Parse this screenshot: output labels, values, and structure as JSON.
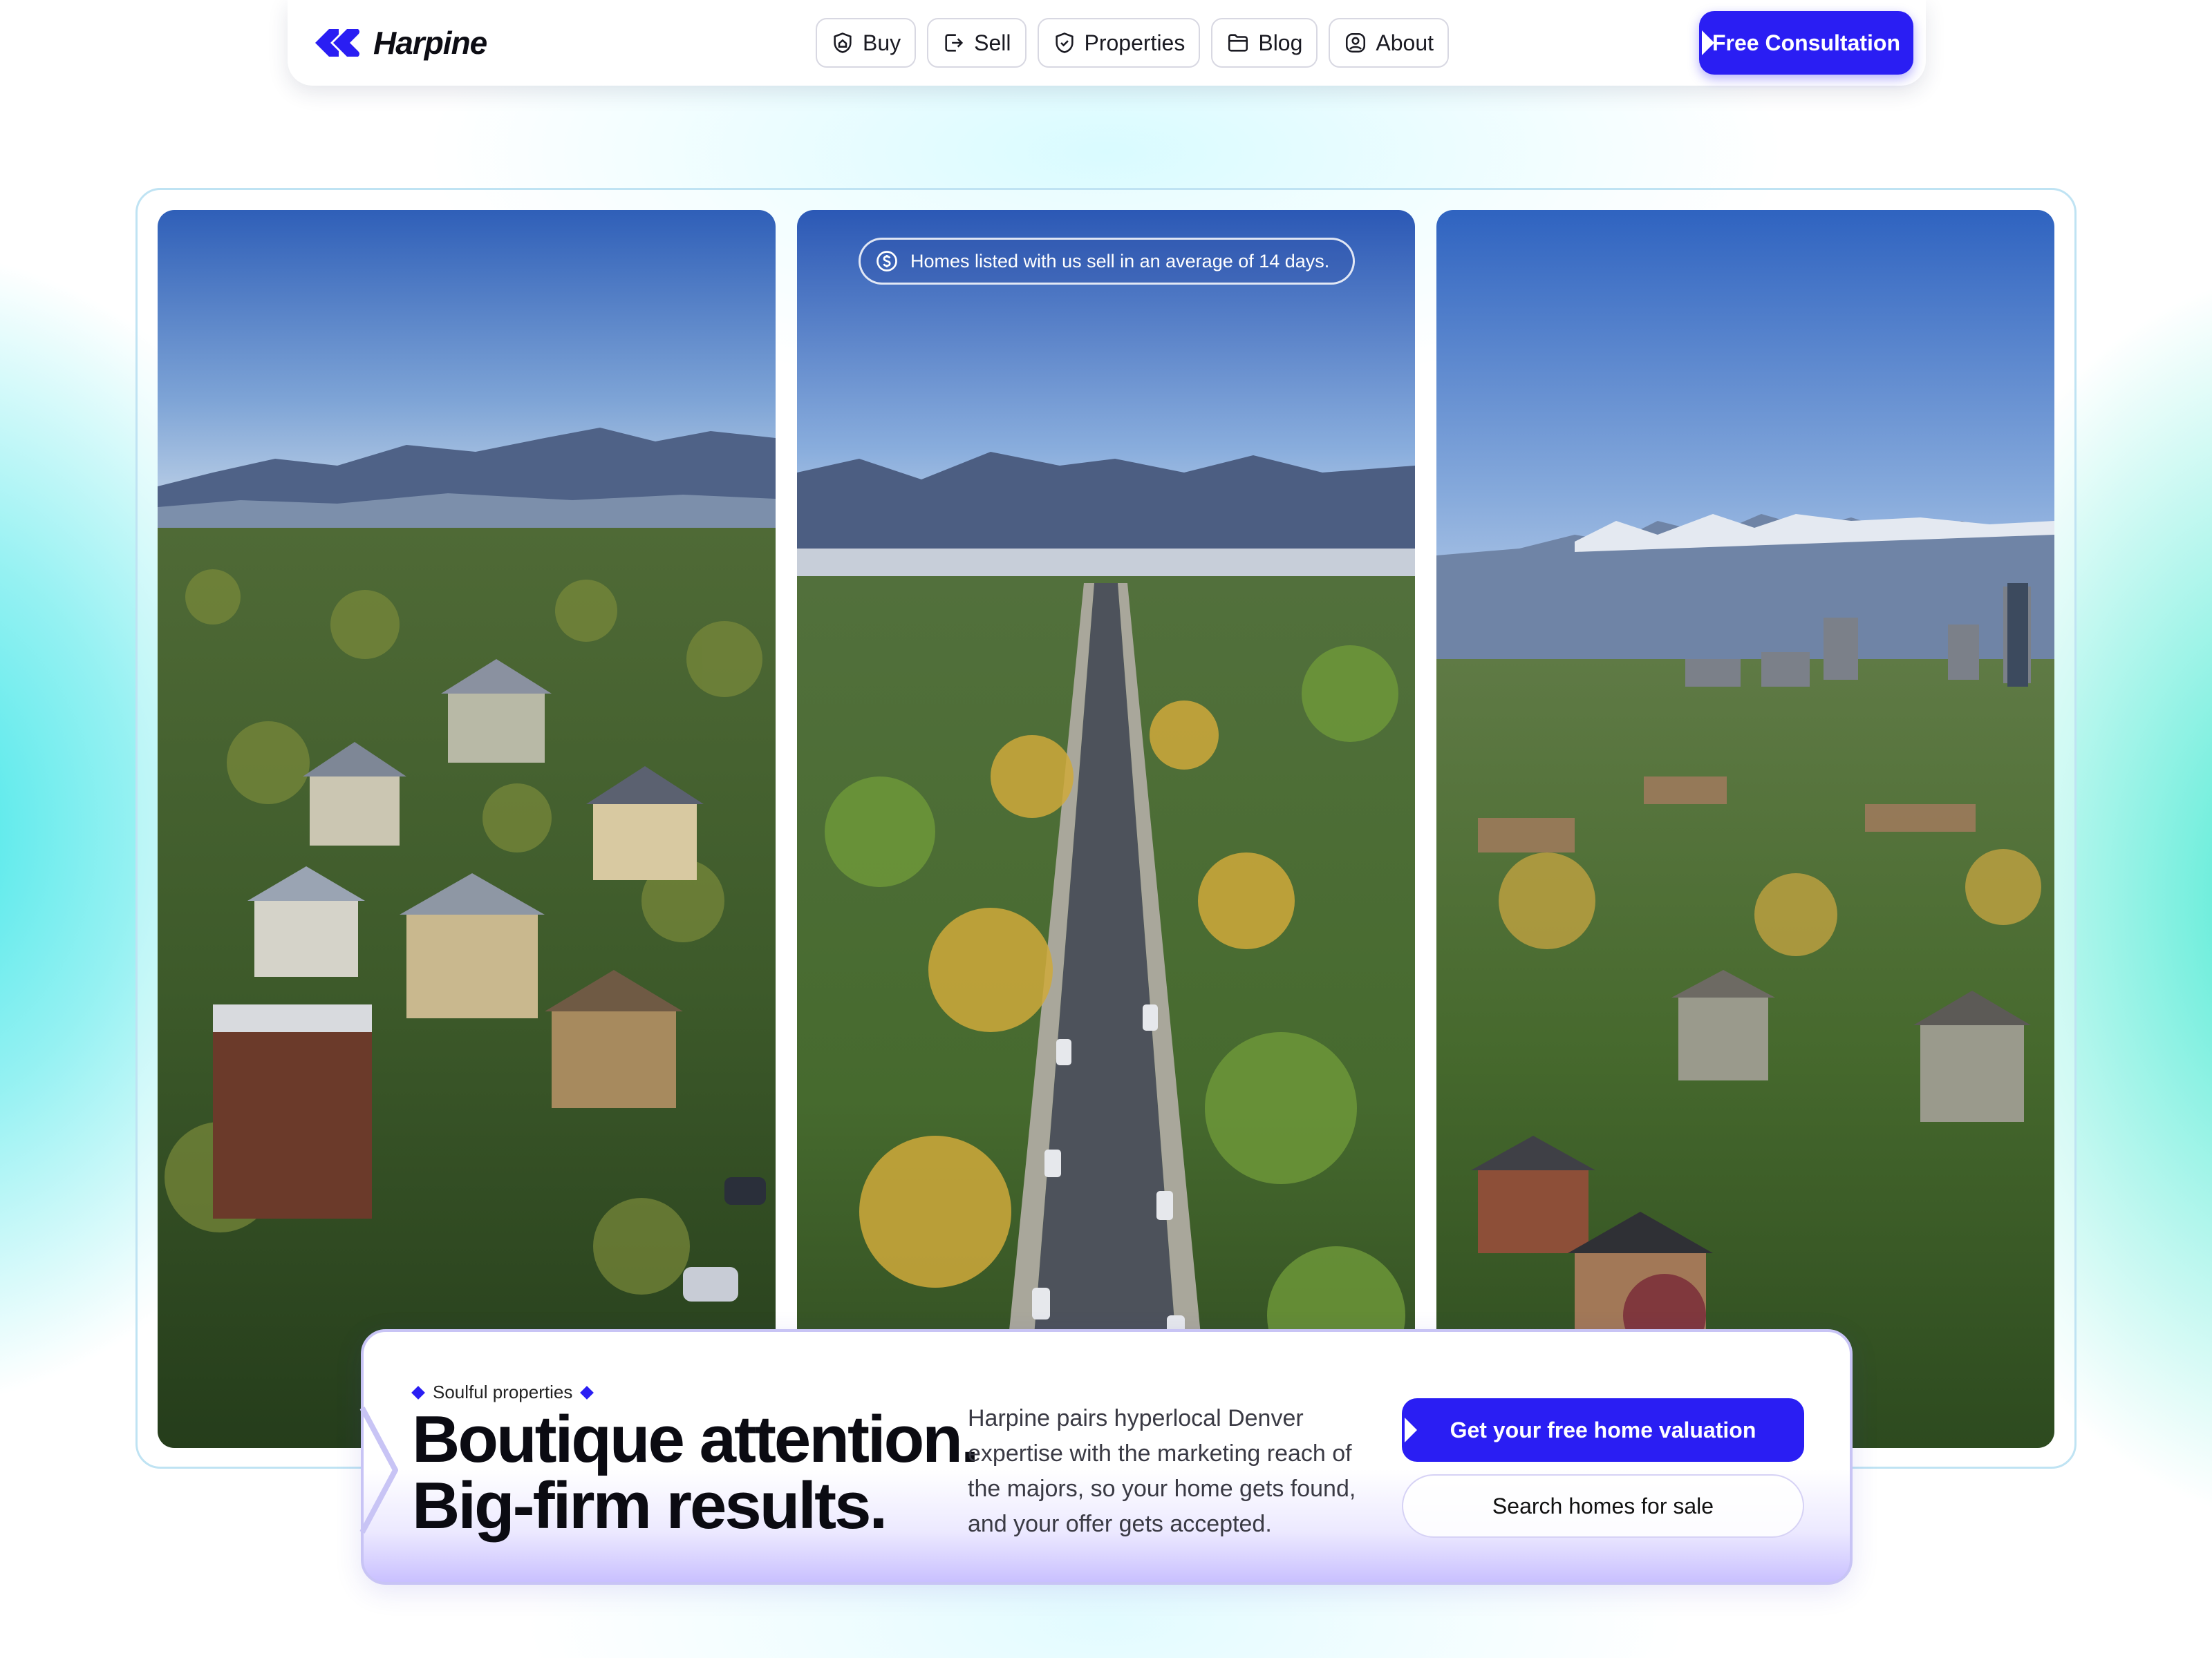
{
  "brand": {
    "name": "Harpine",
    "logo_icon": "double-chevron-logo-icon",
    "accent": "#2a1ef3"
  },
  "nav": {
    "items": [
      {
        "label": "Buy",
        "icon": "shield-house-icon"
      },
      {
        "label": "Sell",
        "icon": "exit-arrow-icon"
      },
      {
        "label": "Properties",
        "icon": "shield-check-icon"
      },
      {
        "label": "Blog",
        "icon": "folder-icon"
      },
      {
        "label": "About",
        "icon": "user-circle-icon"
      }
    ],
    "cta_label": "Free Consultation"
  },
  "hero": {
    "stat_text": "Homes listed with us sell in an average of 14 days.",
    "stat_icon": "dollar-coin-icon",
    "panels": [
      {
        "scene": "aerial-neighborhood-houses"
      },
      {
        "scene": "aerial-tree-lined-street"
      },
      {
        "scene": "aerial-city-skyline-mountains"
      }
    ]
  },
  "card": {
    "eyebrow": "Soulful properties",
    "headline_line1": "Boutique attention.",
    "headline_line2": "Big-firm results.",
    "description": "Harpine pairs hyperlocal Denver expertise with the marketing reach of the majors, so your home gets found, and your offer gets accepted.",
    "primary_button": "Get your free home valuation",
    "secondary_button": "Search homes for sale"
  }
}
